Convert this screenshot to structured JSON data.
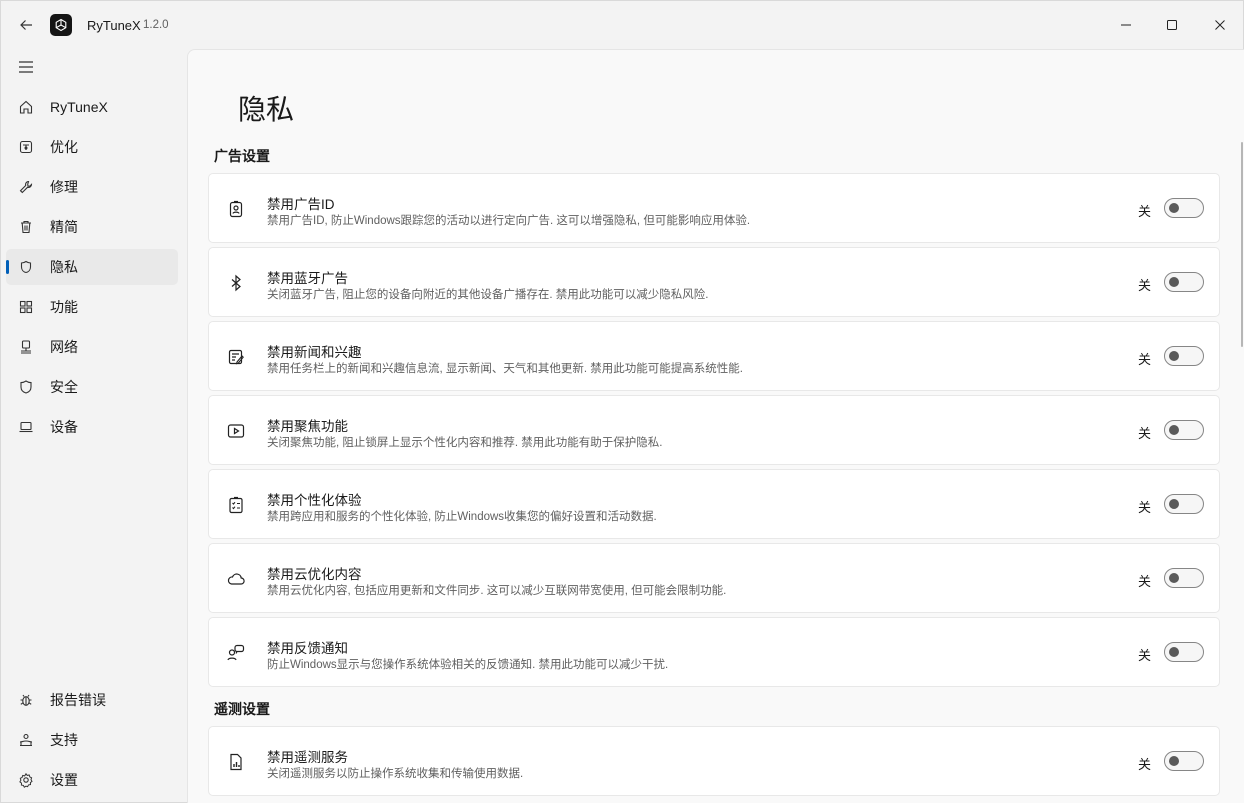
{
  "app": {
    "title": "RyTuneX",
    "version": "1.2.0"
  },
  "sidebar": {
    "items": [
      {
        "label": "RyTuneX",
        "icon": "home-icon"
      },
      {
        "label": "优化",
        "icon": "optimize-icon"
      },
      {
        "label": "修理",
        "icon": "wrench-icon"
      },
      {
        "label": "精简",
        "icon": "trash-icon"
      },
      {
        "label": "隐私",
        "icon": "privacy-icon",
        "active": true
      },
      {
        "label": "功能",
        "icon": "features-icon"
      },
      {
        "label": "网络",
        "icon": "network-icon"
      },
      {
        "label": "安全",
        "icon": "shield-icon"
      },
      {
        "label": "设备",
        "icon": "laptop-icon"
      }
    ],
    "footer": [
      {
        "label": "报告错误",
        "icon": "bug-icon"
      },
      {
        "label": "支持",
        "icon": "support-icon"
      },
      {
        "label": "设置",
        "icon": "gear-icon"
      }
    ]
  },
  "page": {
    "title": "隐私",
    "sections": [
      {
        "title": "广告设置",
        "cards": [
          {
            "icon": "id-badge-icon",
            "title": "禁用广告ID",
            "desc": "禁用广告ID, 防止Windows跟踪您的活动以进行定向广告. 这可以增强隐私, 但可能影响应用体验.",
            "toggle": "关",
            "on": false
          },
          {
            "icon": "bluetooth-icon",
            "title": "禁用蓝牙广告",
            "desc": "关闭蓝牙广告, 阻止您的设备向附近的其他设备广播存在. 禁用此功能可以减少隐私风险.",
            "toggle": "关",
            "on": false
          },
          {
            "icon": "news-icon",
            "title": "禁用新闻和兴趣",
            "desc": "禁用任务栏上的新闻和兴趣信息流, 显示新闻、天气和其他更新. 禁用此功能可能提高系统性能.",
            "toggle": "关",
            "on": false
          },
          {
            "icon": "spotlight-icon",
            "title": "禁用聚焦功能",
            "desc": "关闭聚焦功能, 阻止锁屏上显示个性化内容和推荐. 禁用此功能有助于保护隐私.",
            "toggle": "关",
            "on": false
          },
          {
            "icon": "checklist-icon",
            "title": "禁用个性化体验",
            "desc": "禁用跨应用和服务的个性化体验, 防止Windows收集您的偏好设置和活动数据.",
            "toggle": "关",
            "on": false
          },
          {
            "icon": "cloud-icon",
            "title": "禁用云优化内容",
            "desc": "禁用云优化内容, 包括应用更新和文件同步. 这可以减少互联网带宽使用, 但可能会限制功能.",
            "toggle": "关",
            "on": false
          },
          {
            "icon": "feedback-icon",
            "title": "禁用反馈通知",
            "desc": "防止Windows显示与您操作系统体验相关的反馈通知. 禁用此功能可以减少干扰.",
            "toggle": "关",
            "on": false
          }
        ]
      },
      {
        "title": "遥测设置",
        "cards": [
          {
            "icon": "telemetry-icon",
            "title": "禁用遥测服务",
            "desc": "关闭遥测服务以防止操作系统收集和传输使用数据.",
            "toggle": "关",
            "on": false
          }
        ]
      }
    ]
  }
}
